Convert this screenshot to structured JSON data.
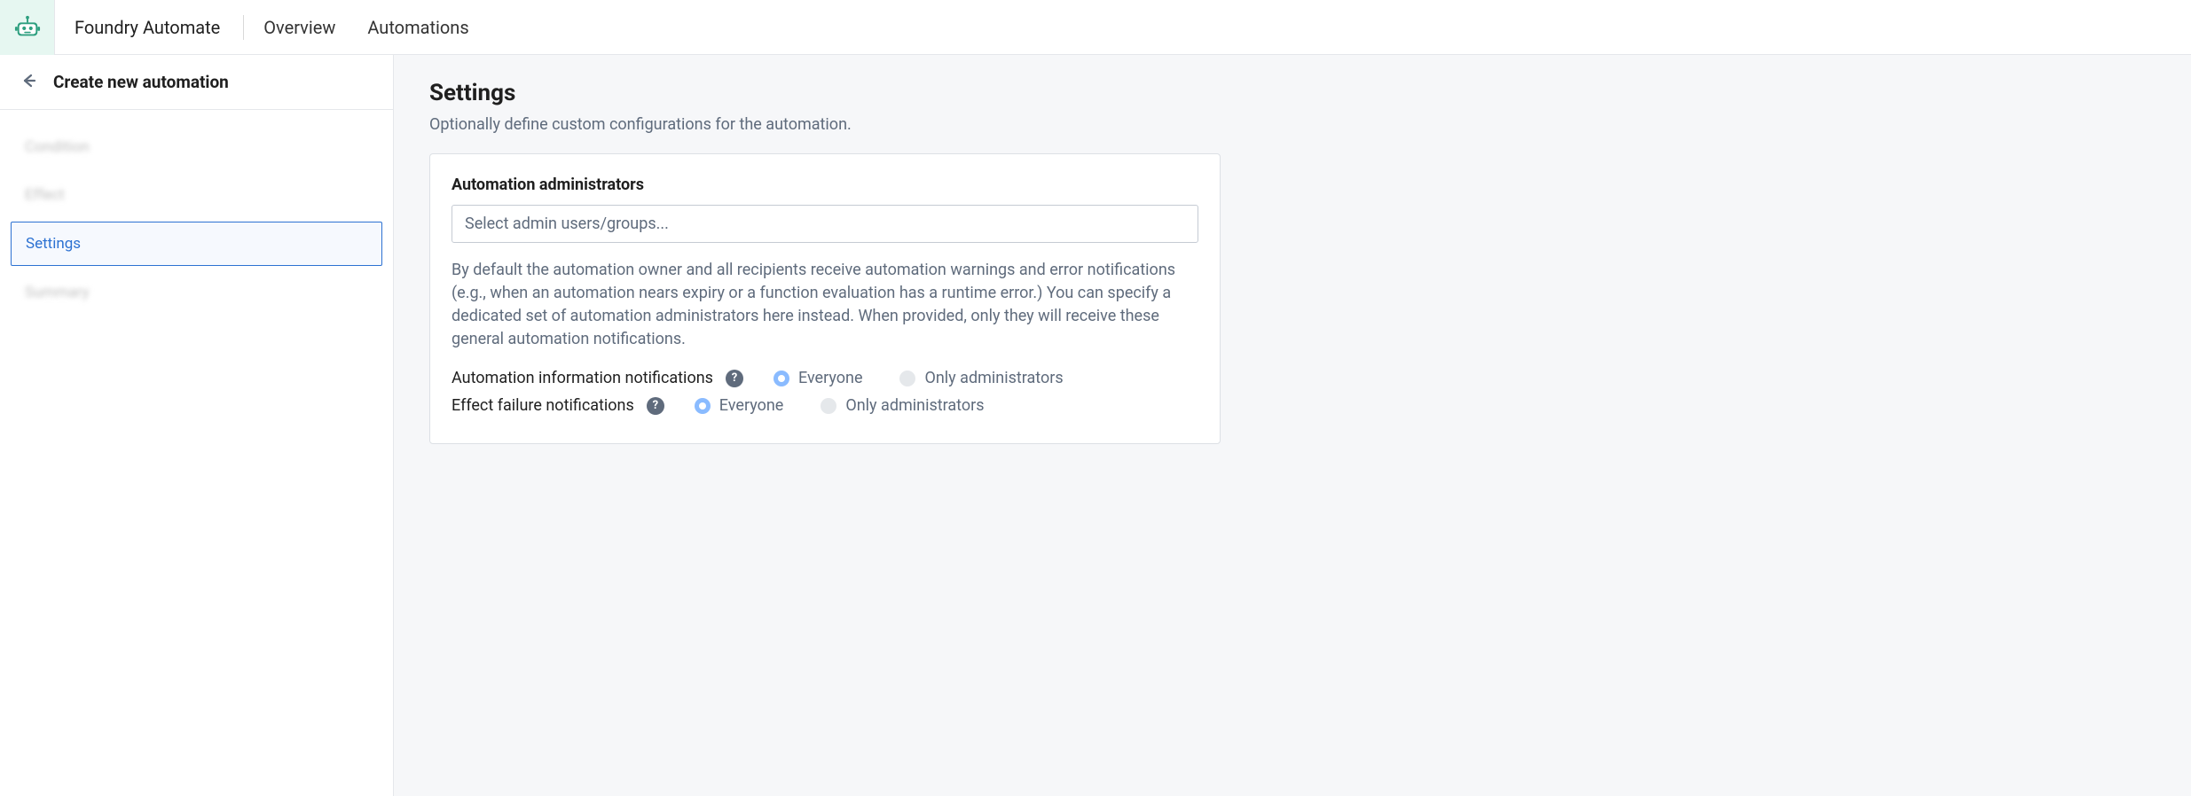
{
  "header": {
    "app_title": "Foundry Automate",
    "nav": {
      "overview": "Overview",
      "automations": "Automations"
    }
  },
  "sidebar": {
    "title": "Create new automation",
    "steps": {
      "condition": "Condition",
      "effect": "Effect",
      "settings": "Settings",
      "summary": "Summary"
    }
  },
  "main": {
    "title": "Settings",
    "subtitle": "Optionally define custom configurations for the automation.",
    "admins": {
      "label": "Automation administrators",
      "placeholder": "Select admin users/groups...",
      "help": "By default the automation owner and all recipients receive automation warnings and error notifications (e.g., when an automation nears expiry or a function evaluation has a runtime error.) You can specify a dedicated set of automation administrators here instead. When provided, only they will receive these general automation notifications."
    },
    "info_notifications": {
      "label": "Automation information notifications",
      "options": {
        "everyone": "Everyone",
        "only_admins": "Only administrators"
      },
      "selected": "everyone"
    },
    "failure_notifications": {
      "label": "Effect failure notifications",
      "options": {
        "everyone": "Everyone",
        "only_admins": "Only administrators"
      },
      "selected": "everyone"
    }
  }
}
